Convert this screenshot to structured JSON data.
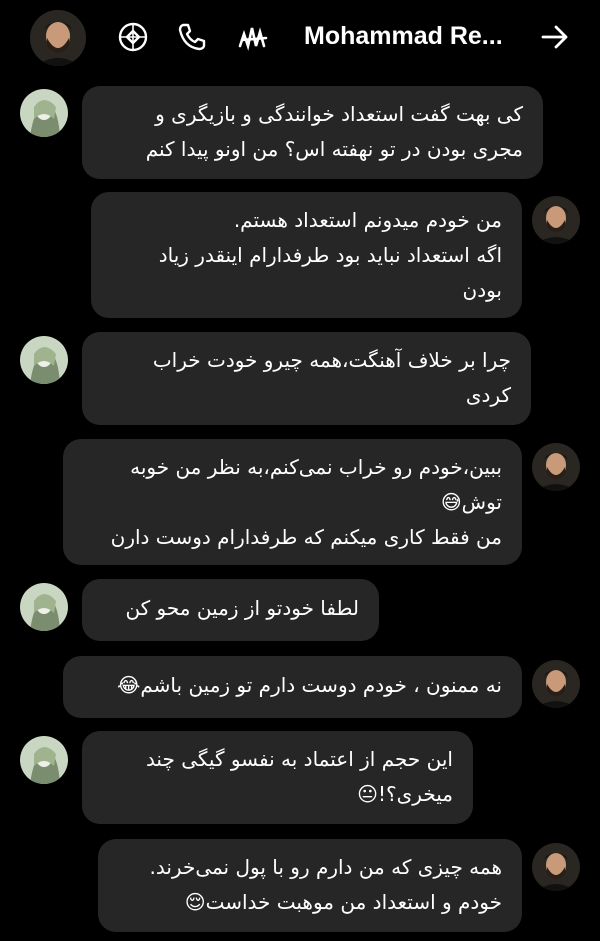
{
  "header": {
    "contact_name": "Mohammad Re...",
    "icons": [
      "contact-avatar",
      "instagram-icon",
      "phone-icon",
      "app-logo-icon",
      "forward-arrow-icon"
    ]
  },
  "colors": {
    "background": "#000000",
    "bubble": "#262626",
    "text": "#ffffff"
  },
  "messages": [
    {
      "sender": "other",
      "lines": [
        "کی بهت گفت استعداد خوانندگی و بازیگری و",
        "مجری بودن در تو نهفته اس؟ من اونو پیدا کنم"
      ]
    },
    {
      "sender": "self",
      "lines": [
        "من خودم میدونم استعداد هستم.",
        "اگه استعداد نباید بود طرفدارام اینقدر زیاد",
        "بودن"
      ]
    },
    {
      "sender": "other",
      "lines": [
        "چرا بر خلاف آهنگت،همه چیرو خودت خراب",
        "کردی"
      ]
    },
    {
      "sender": "self",
      "lines": [
        "ببین،خودم رو خراب نمی‌کنم،به نظر من خوبه",
        "توش😅",
        "من فقط کاری میکنم که طرفدارام دوست دارن"
      ]
    },
    {
      "sender": "other",
      "lines": [
        "لطفا خودتو از زمین محو کن"
      ]
    },
    {
      "sender": "self",
      "lines": [
        "نه ممنون ، خودم دوست دارم تو زمین باشم😂"
      ]
    },
    {
      "sender": "other",
      "lines": [
        "این حجم از اعتماد به نفسو گیگی چند",
        "میخری؟!😐"
      ]
    },
    {
      "sender": "self",
      "lines": [
        "همه چیزی که من دارم رو با پول نمی‌خرند.",
        "خودم و استعداد من موهبت خداست😌"
      ]
    }
  ]
}
